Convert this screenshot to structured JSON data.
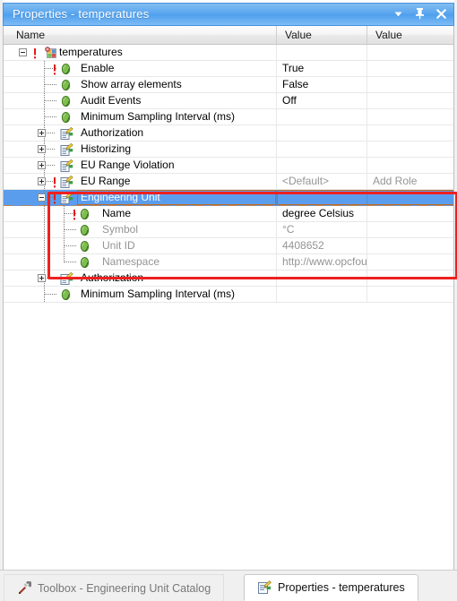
{
  "window": {
    "title": "Properties - temperatures",
    "buttons": [
      {
        "name": "window-menu-chevron",
        "icon": "chevron-down-icon"
      },
      {
        "name": "auto-hide-pin",
        "icon": "pin-icon"
      },
      {
        "name": "close",
        "icon": "close-icon"
      }
    ]
  },
  "grid": {
    "columns": [
      "Name",
      "Value",
      "Value"
    ],
    "rows": [
      {
        "label": "temperatures",
        "indent": 0,
        "twist": "minus",
        "icon": "property-grid-icon",
        "bang": true,
        "value": "",
        "value2": "",
        "dimLabel": false,
        "dimValue": false,
        "selected": false
      },
      {
        "label": "Enable",
        "indent": 1,
        "twist": "none",
        "icon": "green-gem-icon",
        "bang": true,
        "value": "True",
        "value2": "",
        "dimLabel": false,
        "dimValue": false,
        "selected": false
      },
      {
        "label": "Show array elements",
        "indent": 1,
        "twist": "none",
        "icon": "green-gem-icon",
        "bang": false,
        "value": "False",
        "value2": "",
        "dimLabel": false,
        "dimValue": false,
        "selected": false
      },
      {
        "label": "Audit Events",
        "indent": 1,
        "twist": "none",
        "icon": "green-gem-icon",
        "bang": false,
        "value": "Off",
        "value2": "",
        "dimLabel": false,
        "dimValue": false,
        "selected": false
      },
      {
        "label": "Minimum Sampling Interval (ms)",
        "indent": 1,
        "twist": "none",
        "icon": "green-gem-icon",
        "bang": false,
        "value": "",
        "value2": "",
        "dimLabel": false,
        "dimValue": false,
        "selected": false
      },
      {
        "label": "Authorization",
        "indent": 1,
        "twist": "plus",
        "icon": "form-pencil-icon",
        "bang": false,
        "value": "",
        "value2": "",
        "dimLabel": false,
        "dimValue": false,
        "selected": false
      },
      {
        "label": "Historizing",
        "indent": 1,
        "twist": "plus",
        "icon": "form-pencil-icon",
        "bang": false,
        "value": "",
        "value2": "",
        "dimLabel": false,
        "dimValue": false,
        "selected": false
      },
      {
        "label": "EU Range Violation",
        "indent": 1,
        "twist": "plus",
        "icon": "form-pencil-icon",
        "bang": false,
        "value": "",
        "value2": "",
        "dimLabel": false,
        "dimValue": false,
        "selected": false
      },
      {
        "label": "EU Range",
        "indent": 1,
        "twist": "plus",
        "icon": "form-pencil-icon",
        "bang": true,
        "value": "<Default>",
        "value2": "Add Role",
        "dimLabel": false,
        "dimValue": true,
        "selected": false
      },
      {
        "label": "Engineering Unit",
        "indent": 1,
        "twist": "minus",
        "icon": "form-pencil-icon",
        "bang": true,
        "value": "",
        "value2": "",
        "dimLabel": false,
        "dimValue": false,
        "selected": true
      },
      {
        "label": "Name",
        "indent": 2,
        "twist": "none",
        "icon": "green-gem-icon",
        "bang": true,
        "value": "degree Celsius",
        "value2": "",
        "dimLabel": false,
        "dimValue": false,
        "selected": false
      },
      {
        "label": "Symbol",
        "indent": 2,
        "twist": "none",
        "icon": "green-gem-icon",
        "bang": false,
        "value": "°C",
        "value2": "",
        "dimLabel": true,
        "dimValue": true,
        "selected": false
      },
      {
        "label": "Unit ID",
        "indent": 2,
        "twist": "none",
        "icon": "green-gem-icon",
        "bang": false,
        "value": "4408652",
        "value2": "",
        "dimLabel": true,
        "dimValue": true,
        "selected": false
      },
      {
        "label": "Namespace",
        "indent": 2,
        "twist": "none",
        "icon": "green-gem-icon",
        "bang": false,
        "value": "http://www.opcfoundation.org/...",
        "value2": "",
        "dimLabel": true,
        "dimValue": true,
        "selected": false
      },
      {
        "label": "Authorization",
        "indent": 1,
        "twist": "plus",
        "icon": "form-pencil-icon",
        "bang": false,
        "value": "",
        "value2": "",
        "dimLabel": false,
        "dimValue": false,
        "selected": false
      },
      {
        "label": "Minimum Sampling Interval (ms)",
        "indent": 1,
        "twist": "none",
        "icon": "green-gem-icon",
        "bang": false,
        "value": "",
        "value2": "",
        "dimLabel": false,
        "dimValue": false,
        "selected": false
      }
    ]
  },
  "annotation": {
    "name": "red-highlight-rectangle",
    "color": "#ee2020"
  },
  "tabs": [
    {
      "label": "Toolbox - Engineering Unit Catalog",
      "icon": "toolbox-icon",
      "active": false
    },
    {
      "label": "Properties - temperatures",
      "icon": "form-pencil-icon",
      "active": true
    }
  ],
  "colors": {
    "selection": "#5b9ded",
    "title_bar": "#5aa6ee",
    "annotation": "#ee2020",
    "edit_border": "#c06a1e",
    "dim_text": "#949494"
  }
}
